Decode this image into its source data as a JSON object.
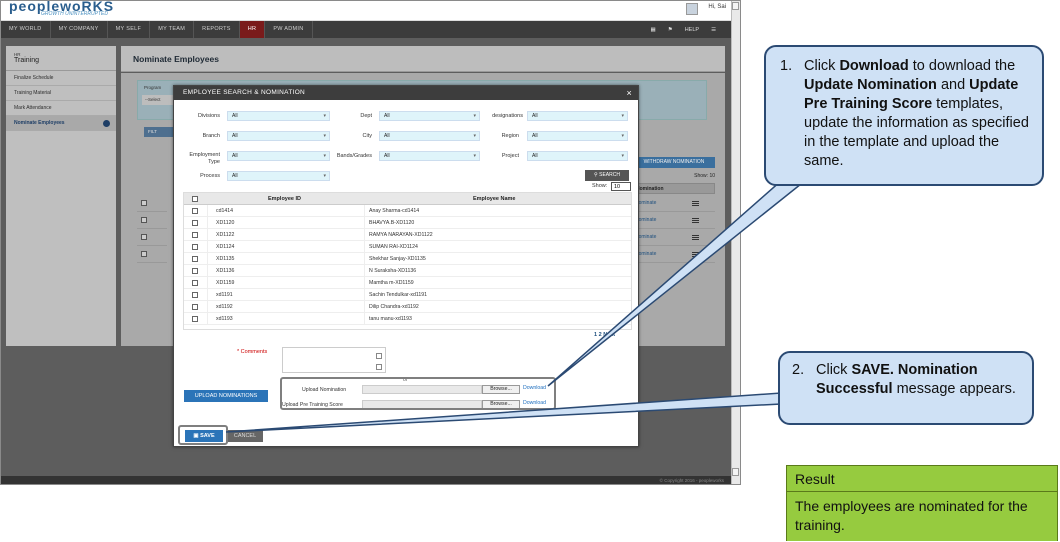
{
  "app": {
    "logo": "peoplewoRKS",
    "tagline": "GROWTH UNINTERRUPTED",
    "user": "Hi, Sai",
    "nav": [
      "MY WORLD",
      "MY COMPANY",
      "MY SELF",
      "MY TEAM",
      "REPORTS",
      "HR",
      "PW ADMIN"
    ],
    "nav_active": "HR",
    "nav_right": {
      "help": "HELP"
    },
    "footer": "© Copyright 2016 - peopleworks"
  },
  "sidebar": {
    "section": "HR",
    "title": "Training",
    "items": [
      "Finalize Schedule",
      "Training Material",
      "Mark Attendance",
      "Nominate Employees"
    ],
    "active": "Nominate Employees"
  },
  "page": {
    "title": "Nominate Employees",
    "bg": {
      "program_label": "Program",
      "select_placeholder": "--Select",
      "filter_btn": "FILT",
      "withdraw_btn": "WITHDRAW NOMINATION",
      "show_label": "Show:",
      "show_value": "10",
      "col_nomination": "Nomination",
      "row_labels": [
        "Nominate",
        "Nominate",
        "Nominate",
        "Nominate"
      ]
    }
  },
  "modal": {
    "title": "EMPLOYEE SEARCH & NOMINATION",
    "close": "×",
    "filters": {
      "divisions": {
        "label": "Divisions",
        "value": "All"
      },
      "dept": {
        "label": "Dept",
        "value": "All"
      },
      "designations": {
        "label": "designations",
        "value": "All"
      },
      "branch": {
        "label": "Branch",
        "value": "All"
      },
      "city": {
        "label": "City",
        "value": "All"
      },
      "region": {
        "label": "Region",
        "value": "All"
      },
      "employment_type": {
        "label": "Employment Type",
        "value": "All"
      },
      "bands_grades": {
        "label": "Bands/Grades",
        "value": "All"
      },
      "project": {
        "label": "Project",
        "value": "All"
      },
      "process": {
        "label": "Process",
        "value": "All"
      }
    },
    "search_btn": "SEARCH",
    "show_label": "Show:",
    "show_value": "10",
    "columns": {
      "id": "Employee ID",
      "name": "Employee Name"
    },
    "rows": [
      {
        "id": "cd1414",
        "name": "Anay Sharma-cd1414"
      },
      {
        "id": "XD1120",
        "name": "BHAVYA.B-XD1120"
      },
      {
        "id": "XD1122",
        "name": "RAMYA NARAYAN-XD1122"
      },
      {
        "id": "XD1124",
        "name": "SUMAN RAI-XD1124"
      },
      {
        "id": "XD1135",
        "name": "Shekhar Sanjay-XD1135"
      },
      {
        "id": "XD1136",
        "name": "N Suraksha-XD1136"
      },
      {
        "id": "XD1159",
        "name": "Mamtha m-XD1159"
      },
      {
        "id": "xd1191",
        "name": "Sachin Tendulkar-xd1191"
      },
      {
        "id": "xd1192",
        "name": "Dilip Chandra-xd1192"
      },
      {
        "id": "xd1193",
        "name": "tanu manu-xd1193"
      }
    ],
    "pager": {
      "p1": "1",
      "p2": "2",
      "next": "Next"
    },
    "comments_label": "Comments",
    "or": "or",
    "upload_nominations_btn": "UPLOAD NOMINATIONS",
    "upload_nomination_label": "Upload Nomination",
    "upload_pre_label": "Upload Pre Training Score",
    "browse": "Browse...",
    "download": "Download",
    "save_btn": "SAVE",
    "cancel_btn": "CANCEL"
  },
  "callouts": {
    "c1": {
      "num": "1.",
      "t1": "Click ",
      "b1": "Download",
      "t2": " to download the ",
      "b2": "Update Nomination",
      "t3": " and ",
      "b3": "Update Pre Training Score",
      "t4": " templates, update the information as specified in the template and upload the same."
    },
    "c2": {
      "num": "2.",
      "t1": "Click ",
      "b1": "SAVE. Nomination Successful",
      "t2": " message appears."
    }
  },
  "result": {
    "heading": "Result",
    "text": "The employees are nominated  for the training."
  }
}
